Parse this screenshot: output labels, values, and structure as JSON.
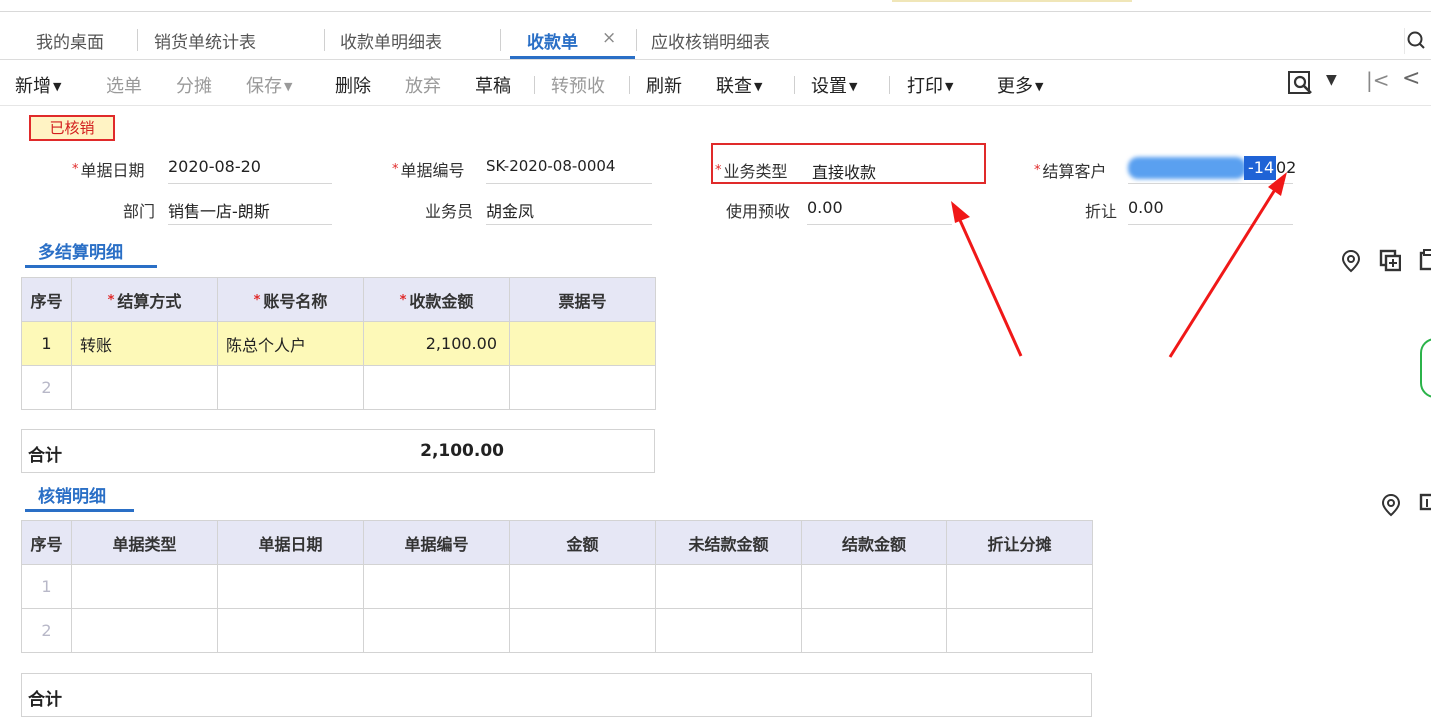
{
  "tabs": [
    {
      "label": "我的桌面"
    },
    {
      "label": "销货单统计表"
    },
    {
      "label": "收款单明细表"
    },
    {
      "label": "收款单"
    },
    {
      "label": "应收核销明细表"
    }
  ],
  "tab_close": "×",
  "toolbar": {
    "new": "新增",
    "select": "选单",
    "allocate": "分摊",
    "save": "保存",
    "delete": "删除",
    "discard": "放弃",
    "draft": "草稿",
    "to_prepay": "转预收",
    "refresh": "刷新",
    "linked_query": "联查",
    "settings": "设置",
    "print": "打印",
    "more": "更多",
    "first": "|<",
    "prev": "<"
  },
  "status_badge": "已核销",
  "form": {
    "date_label": "单据日期",
    "date_value": "2020-08-20",
    "number_label": "单据编号",
    "number_value": "SK-2020-08-0004",
    "biz_type_label": "业务类型",
    "biz_type_value": "直接收款",
    "customer_label": "结算客户",
    "customer_value_selected": "-14",
    "customer_value_tail": "02",
    "dept_label": "部门",
    "dept_value": "销售一店-朗斯",
    "salesperson_label": "业务员",
    "salesperson_value": "胡金凤",
    "use_prepay_label": "使用预收",
    "use_prepay_value": "0.00",
    "discount_label": "折让",
    "discount_value": "0.00"
  },
  "settlement": {
    "title": "多结算明细",
    "columns": [
      "序号",
      "结算方式",
      "账号名称",
      "收款金额",
      "票据号"
    ],
    "rows": [
      {
        "idx": "1",
        "method": "转账",
        "account": "陈总个人户",
        "amount": "2,100.00",
        "bill_no": ""
      },
      {
        "idx": "2",
        "method": "",
        "account": "",
        "amount": "",
        "bill_no": ""
      }
    ],
    "total_label": "合计",
    "total_value": "2,100.00"
  },
  "writeoff": {
    "title": "核销明细",
    "columns": [
      "序号",
      "单据类型",
      "单据日期",
      "单据编号",
      "金额",
      "未结款金额",
      "结款金额",
      "折让分摊"
    ],
    "rows": [
      {
        "idx": "1"
      },
      {
        "idx": "2"
      }
    ],
    "total_label": "合计"
  },
  "colors": {
    "accent": "#2a6fc6",
    "alert_red": "#e02a2a",
    "header_bg": "#e6e7f5",
    "selected_row": "#fdf9b8"
  }
}
